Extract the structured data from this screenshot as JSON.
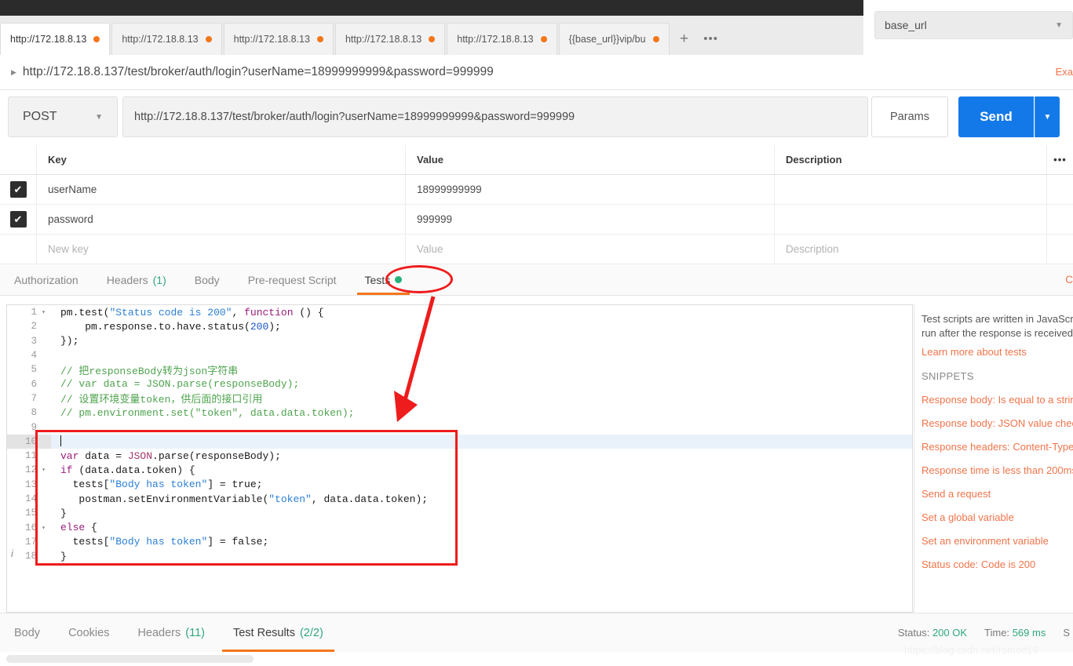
{
  "tabs": {
    "items": [
      {
        "label": "http://172.18.8.13",
        "active": true
      },
      {
        "label": "http://172.18.8.13",
        "active": false
      },
      {
        "label": "http://172.18.8.13",
        "active": false
      },
      {
        "label": "http://172.18.8.13",
        "active": false
      },
      {
        "label": "http://172.18.8.13",
        "active": false
      },
      {
        "label": "{{base_url}}vip/bu",
        "active": false
      }
    ],
    "new_tab": "+",
    "more": "•••"
  },
  "environment": {
    "selected": "base_url",
    "caret": "▼"
  },
  "request": {
    "title": "http://172.18.8.137/test/broker/auth/login?userName=18999999999&password=999999",
    "expand_triangle": "▶",
    "examples_label": "Exa",
    "method": "POST",
    "method_caret": "▼",
    "url": "http://172.18.8.137/test/broker/auth/login?userName=18999999999&password=999999",
    "params_label": "Params",
    "send_label": "Send",
    "send_caret": "▼"
  },
  "params_table": {
    "headers": {
      "key": "Key",
      "value": "Value",
      "description": "Description",
      "more": "•••"
    },
    "rows": [
      {
        "checked": true,
        "check_glyph": "✔",
        "key": "userName",
        "value": "18999999999",
        "description": ""
      },
      {
        "checked": true,
        "check_glyph": "✔",
        "key": "password",
        "value": "999999",
        "description": ""
      }
    ],
    "new_row": {
      "key": "New key",
      "value": "Value",
      "description": "Description"
    }
  },
  "request_tabs": {
    "items": [
      {
        "label": "Authorization",
        "count": "",
        "active": false,
        "dot": false
      },
      {
        "label": "Headers",
        "count": "(1)",
        "active": false,
        "dot": false
      },
      {
        "label": "Body",
        "count": "",
        "active": false,
        "dot": false
      },
      {
        "label": "Pre-request Script",
        "count": "",
        "active": false,
        "dot": false
      },
      {
        "label": "Tests",
        "count": "",
        "active": true,
        "dot": true
      }
    ],
    "cookies_link": "C"
  },
  "editor": {
    "current_line": 10,
    "info_glyph": "i",
    "lines": [
      {
        "num": "1",
        "fold": "▾",
        "tokens": [
          {
            "t": "pm",
            "c": "def"
          },
          {
            "t": ".",
            "c": "def"
          },
          {
            "t": "test",
            "c": "def"
          },
          {
            "t": "(",
            "c": "def"
          },
          {
            "t": "\"Status code is 200\"",
            "c": "str"
          },
          {
            "t": ", ",
            "c": "def"
          },
          {
            "t": "function",
            "c": "kw"
          },
          {
            "t": " () {",
            "c": "def"
          }
        ]
      },
      {
        "num": "2",
        "fold": "",
        "tokens": [
          {
            "t": "    pm.response.to.have.status(",
            "c": "def"
          },
          {
            "t": "200",
            "c": "num"
          },
          {
            "t": ");",
            "c": "def"
          }
        ]
      },
      {
        "num": "3",
        "fold": "",
        "tokens": [
          {
            "t": "});",
            "c": "def"
          }
        ]
      },
      {
        "num": "4",
        "fold": "",
        "tokens": []
      },
      {
        "num": "5",
        "fold": "",
        "tokens": [
          {
            "t": "// 把responseBody转为json字符串",
            "c": "com"
          }
        ]
      },
      {
        "num": "6",
        "fold": "",
        "tokens": [
          {
            "t": "// var data = JSON.parse(responseBody);",
            "c": "com"
          }
        ]
      },
      {
        "num": "7",
        "fold": "",
        "tokens": [
          {
            "t": "// 设置环境变量token，供后面的接口引用",
            "c": "com"
          }
        ]
      },
      {
        "num": "8",
        "fold": "",
        "tokens": [
          {
            "t": "// pm.environment.set(\"token\", data.data.token);",
            "c": "com"
          }
        ]
      },
      {
        "num": "9",
        "fold": "",
        "tokens": []
      },
      {
        "num": "10",
        "fold": "",
        "tokens": [
          {
            "t": "CARET",
            "c": "caret"
          }
        ]
      },
      {
        "num": "11",
        "fold": "",
        "tokens": [
          {
            "t": "var",
            "c": "kw"
          },
          {
            "t": " data = ",
            "c": "def"
          },
          {
            "t": "JSON",
            "c": "var"
          },
          {
            "t": ".parse(responseBody);",
            "c": "def"
          }
        ]
      },
      {
        "num": "12",
        "fold": "▾",
        "tokens": [
          {
            "t": "if",
            "c": "kw"
          },
          {
            "t": " (data.data.token) {",
            "c": "def"
          }
        ]
      },
      {
        "num": "13",
        "fold": "",
        "tokens": [
          {
            "t": "  tests[",
            "c": "def"
          },
          {
            "t": "\"Body has token\"",
            "c": "str"
          },
          {
            "t": "] = true;",
            "c": "def"
          }
        ]
      },
      {
        "num": "14",
        "fold": "",
        "tokens": [
          {
            "t": "   postman.setEnvironmentVariable(",
            "c": "def"
          },
          {
            "t": "\"token\"",
            "c": "str"
          },
          {
            "t": ", data.data.token);",
            "c": "def"
          }
        ]
      },
      {
        "num": "15",
        "fold": "",
        "tokens": [
          {
            "t": "}",
            "c": "def"
          }
        ]
      },
      {
        "num": "16",
        "fold": "▾",
        "tokens": [
          {
            "t": "else",
            "c": "kw"
          },
          {
            "t": " {",
            "c": "def"
          }
        ]
      },
      {
        "num": "17",
        "fold": "",
        "tokens": [
          {
            "t": "  tests[",
            "c": "def"
          },
          {
            "t": "\"Body has token\"",
            "c": "str"
          },
          {
            "t": "] = false;",
            "c": "def"
          }
        ]
      },
      {
        "num": "18",
        "fold": "",
        "tokens": [
          {
            "t": "}",
            "c": "def"
          }
        ]
      }
    ]
  },
  "snippets": {
    "description_line1": "Test scripts are written in JavaScri",
    "description_line2": "run after the response is received",
    "learn_more": "Learn more about tests",
    "heading": "SNIPPETS",
    "items": [
      "Response body: Is equal to a strin",
      "Response body: JSON value check",
      "Response headers: Content-Type",
      "Response time is less than 200ms",
      "Send a request",
      "Set a global variable",
      "Set an environment variable",
      "Status code: Code is 200"
    ]
  },
  "response": {
    "tabs": [
      {
        "label": "Body",
        "count": "",
        "active": false
      },
      {
        "label": "Cookies",
        "count": "",
        "active": false
      },
      {
        "label": "Headers",
        "count": "(11)",
        "active": false
      },
      {
        "label": "Test Results",
        "count": "(2/2)",
        "active": true
      }
    ],
    "status_label": "Status:",
    "status_value": "200 OK",
    "time_label": "Time:",
    "time_value": "569 ms",
    "size_label": "S"
  },
  "watermark": "https://blog.csdn.net/romon19",
  "colors": {
    "accent_orange": "#f4761a",
    "send_blue": "#1479e8",
    "annotation_red": "#ee1c1c",
    "link_orange": "#f0744a",
    "success_green": "#2fa87a"
  }
}
